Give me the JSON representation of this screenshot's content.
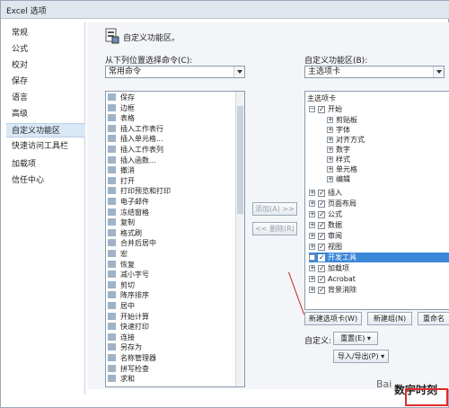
{
  "window": {
    "title": "Excel 选项"
  },
  "nav": {
    "items": [
      {
        "label": "常规"
      },
      {
        "label": "公式"
      },
      {
        "label": "校对"
      },
      {
        "label": "保存"
      },
      {
        "label": "语言"
      },
      {
        "label": "高级"
      },
      {
        "label": "自定义功能区"
      },
      {
        "label": "快速访问工具栏"
      },
      {
        "label": "加载项"
      },
      {
        "label": "信任中心"
      }
    ]
  },
  "main": {
    "header": "自定义功能区。",
    "left_label": "从下列位置选择命令(C):",
    "left_combo": "常用命令",
    "right_label": "自定义功能区(B):",
    "right_combo": "主选项卡",
    "commands": [
      "保存",
      "边框",
      "表格",
      "插入工作表行",
      "插入单元格...",
      "插入工作表列",
      "插入函数...",
      "撤消",
      "打开",
      "打印预览和打印",
      "电子邮件",
      "冻结窗格",
      "复制",
      "格式刷",
      "合并后居中",
      "宏",
      "恢复",
      "减小字号",
      "剪切",
      "降序排序",
      "居中",
      "开始计算",
      "快速打印",
      "连接",
      "另存为",
      "名称管理器",
      "拼写检查",
      "求和"
    ],
    "add_button": "添加(A) >>",
    "remove_button": "<< 删除(R)",
    "tree_header": "主选项卡",
    "tree": {
      "start": "开始",
      "start_children": [
        "剪贴板",
        "字体",
        "对齐方式",
        "数字",
        "样式",
        "单元格",
        "编辑"
      ],
      "tabs": [
        "插入",
        "页面布局",
        "公式",
        "数据",
        "审阅",
        "视图",
        "开发工具",
        "加载项",
        "Acrobat",
        "背景消除"
      ]
    },
    "new_tab_button": "新建选项卡(W)",
    "new_group_button": "新建组(N)",
    "rename_button": "重命名",
    "customize_label": "自定义:",
    "reset_button": "重置(E) ▾",
    "import_export_button": "导入/导出(P) ▾"
  },
  "watermark": {
    "site": "Bai",
    "account": "数字时刻"
  },
  "colors": {
    "selection": "#3b87d8",
    "nav_selected": "#d9e8f7",
    "annotation": "#e02b2b"
  }
}
